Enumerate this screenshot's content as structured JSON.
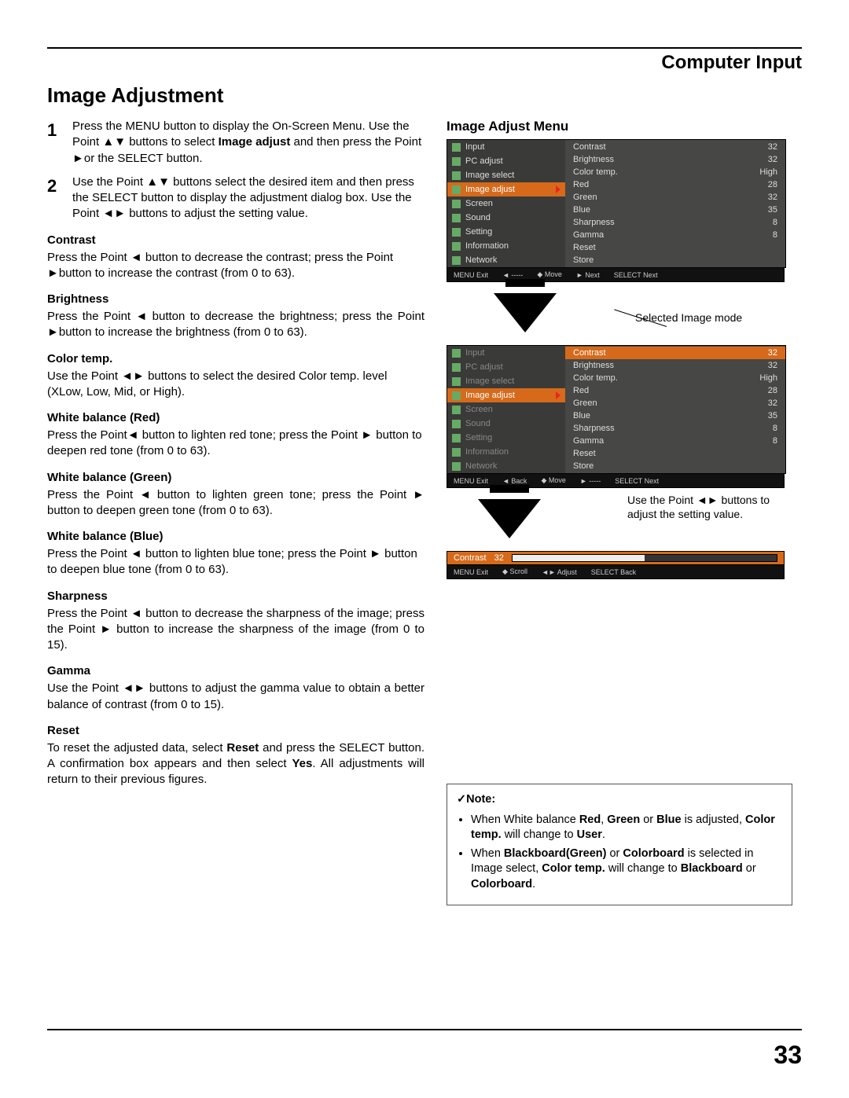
{
  "page": {
    "header": "Computer Input",
    "title": "Image Adjustment",
    "number": "33"
  },
  "steps": [
    {
      "num": "1",
      "text_a": "Press the MENU button to display the On-Screen Menu. Use the Point ▲▼ buttons to select ",
      "bold_a": "Image adjust",
      "text_b": " and then press the Point ►or the SELECT button."
    },
    {
      "num": "2",
      "text_a": "Use the Point ▲▼ buttons select the desired item and then press the SELECT button to display the adjustment dialog box. Use the Point ◄► buttons to adjust the setting value.",
      "bold_a": "",
      "text_b": ""
    }
  ],
  "sections": [
    {
      "h": "Contrast",
      "p": "Press the Point ◄ button to decrease the contrast; press the Point ►button to increase the contrast (from 0 to 63).",
      "justify": false
    },
    {
      "h": "Brightness",
      "p": "Press the Point ◄ button to decrease the brightness; press the Point ►button to increase the brightness (from 0 to 63).",
      "justify": true
    },
    {
      "h": "Color temp.",
      "p": "Use the Point ◄► buttons to select the desired Color temp. level (XLow, Low, Mid, or High).",
      "justify": false
    },
    {
      "h": "White balance (Red)",
      "p": "Press the Point◄ button to lighten red tone; press the Point ► button to deepen red tone (from 0 to 63).",
      "justify": false
    },
    {
      "h": "White balance (Green)",
      "p": "Press the Point ◄ button to lighten green tone; press the Point ► button to deepen green tone (from 0 to 63).",
      "justify": true
    },
    {
      "h": "White balance (Blue)",
      "p": "Press the Point ◄ button to lighten blue tone; press the Point ► button to deepen blue tone (from 0 to 63).",
      "justify": false
    },
    {
      "h": "Sharpness",
      "p": "Press the Point ◄ button to decrease the sharpness of the image; press the Point ► button to increase the sharpness of the image (from 0 to 15).",
      "justify": true
    },
    {
      "h": "Gamma",
      "p": "Use the Point ◄► buttons to adjust the gamma value to obtain a better balance of contrast (from 0 to 15).",
      "justify": true
    }
  ],
  "reset": {
    "h": "Reset",
    "p_a": "To reset the adjusted data, select ",
    "bold_a": "Reset",
    "p_b": " and press the SELECT button. A confirmation box appears and then select ",
    "bold_b": "Yes",
    "p_c": ". All adjustments will return to their previous figures."
  },
  "right": {
    "title": "Image Adjust Menu",
    "callout_selected": "Selected Image mode",
    "callout_usepoint": "Use the Point ◄► buttons to adjust the setting value."
  },
  "osd": {
    "left_items": [
      {
        "name": "Input",
        "ic": "ic-input"
      },
      {
        "name": "PC adjust",
        "ic": "ic-pc"
      },
      {
        "name": "Image select",
        "ic": "ic-imgsel"
      },
      {
        "name": "Image adjust",
        "ic": "ic-imgadj",
        "sel": true
      },
      {
        "name": "Screen",
        "ic": "ic-screen"
      },
      {
        "name": "Sound",
        "ic": "ic-sound"
      },
      {
        "name": "Setting",
        "ic": "ic-setting"
      },
      {
        "name": "Information",
        "ic": "ic-info"
      },
      {
        "name": "Network",
        "ic": "ic-net"
      }
    ],
    "right_items": [
      {
        "k": "Contrast",
        "v": "32"
      },
      {
        "k": "Brightness",
        "v": "32"
      },
      {
        "k": "Color temp.",
        "v": "High"
      },
      {
        "k": "Red",
        "v": "28"
      },
      {
        "k": "Green",
        "v": "32"
      },
      {
        "k": "Blue",
        "v": "35"
      },
      {
        "k": "Sharpness",
        "v": "8"
      },
      {
        "k": "Gamma",
        "v": "8"
      },
      {
        "k": "Reset",
        "v": ""
      },
      {
        "k": "Store",
        "v": ""
      }
    ],
    "foot1": {
      "exit": "MENU Exit",
      "a": "◄ -----",
      "b": "◆ Move",
      "c": "► Next",
      "d": "SELECT Next"
    },
    "foot2": {
      "exit": "MENU Exit",
      "a": "◄ Back",
      "b": "◆ Move",
      "c": "► -----",
      "d": "SELECT Next"
    },
    "slider": {
      "label": "Contrast",
      "value": "32",
      "foot_exit": "MENU Exit",
      "foot_a": "◆ Scroll",
      "foot_b": "◄► Adjust",
      "foot_c": "SELECT Back"
    }
  },
  "note": {
    "h": "✓Note:",
    "li1_a": "When White balance ",
    "li1_b": "Red",
    "li1_c": ", ",
    "li1_d": "Green",
    "li1_e": " or ",
    "li1_f": "Blue",
    "li1_g": " is adjusted, ",
    "li1_h": "Color temp.",
    "li1_i": " will change to ",
    "li1_j": "User",
    "li1_k": ".",
    "li2_a": "When ",
    "li2_b": "Blackboard(Green)",
    "li2_c": " or ",
    "li2_d": "Colorboard",
    "li2_e": " is selected in Image select, ",
    "li2_f": "Color temp.",
    "li2_g": " will change to ",
    "li2_h": "Blackboard",
    "li2_i": " or ",
    "li2_j": "Colorboard",
    "li2_k": "."
  }
}
